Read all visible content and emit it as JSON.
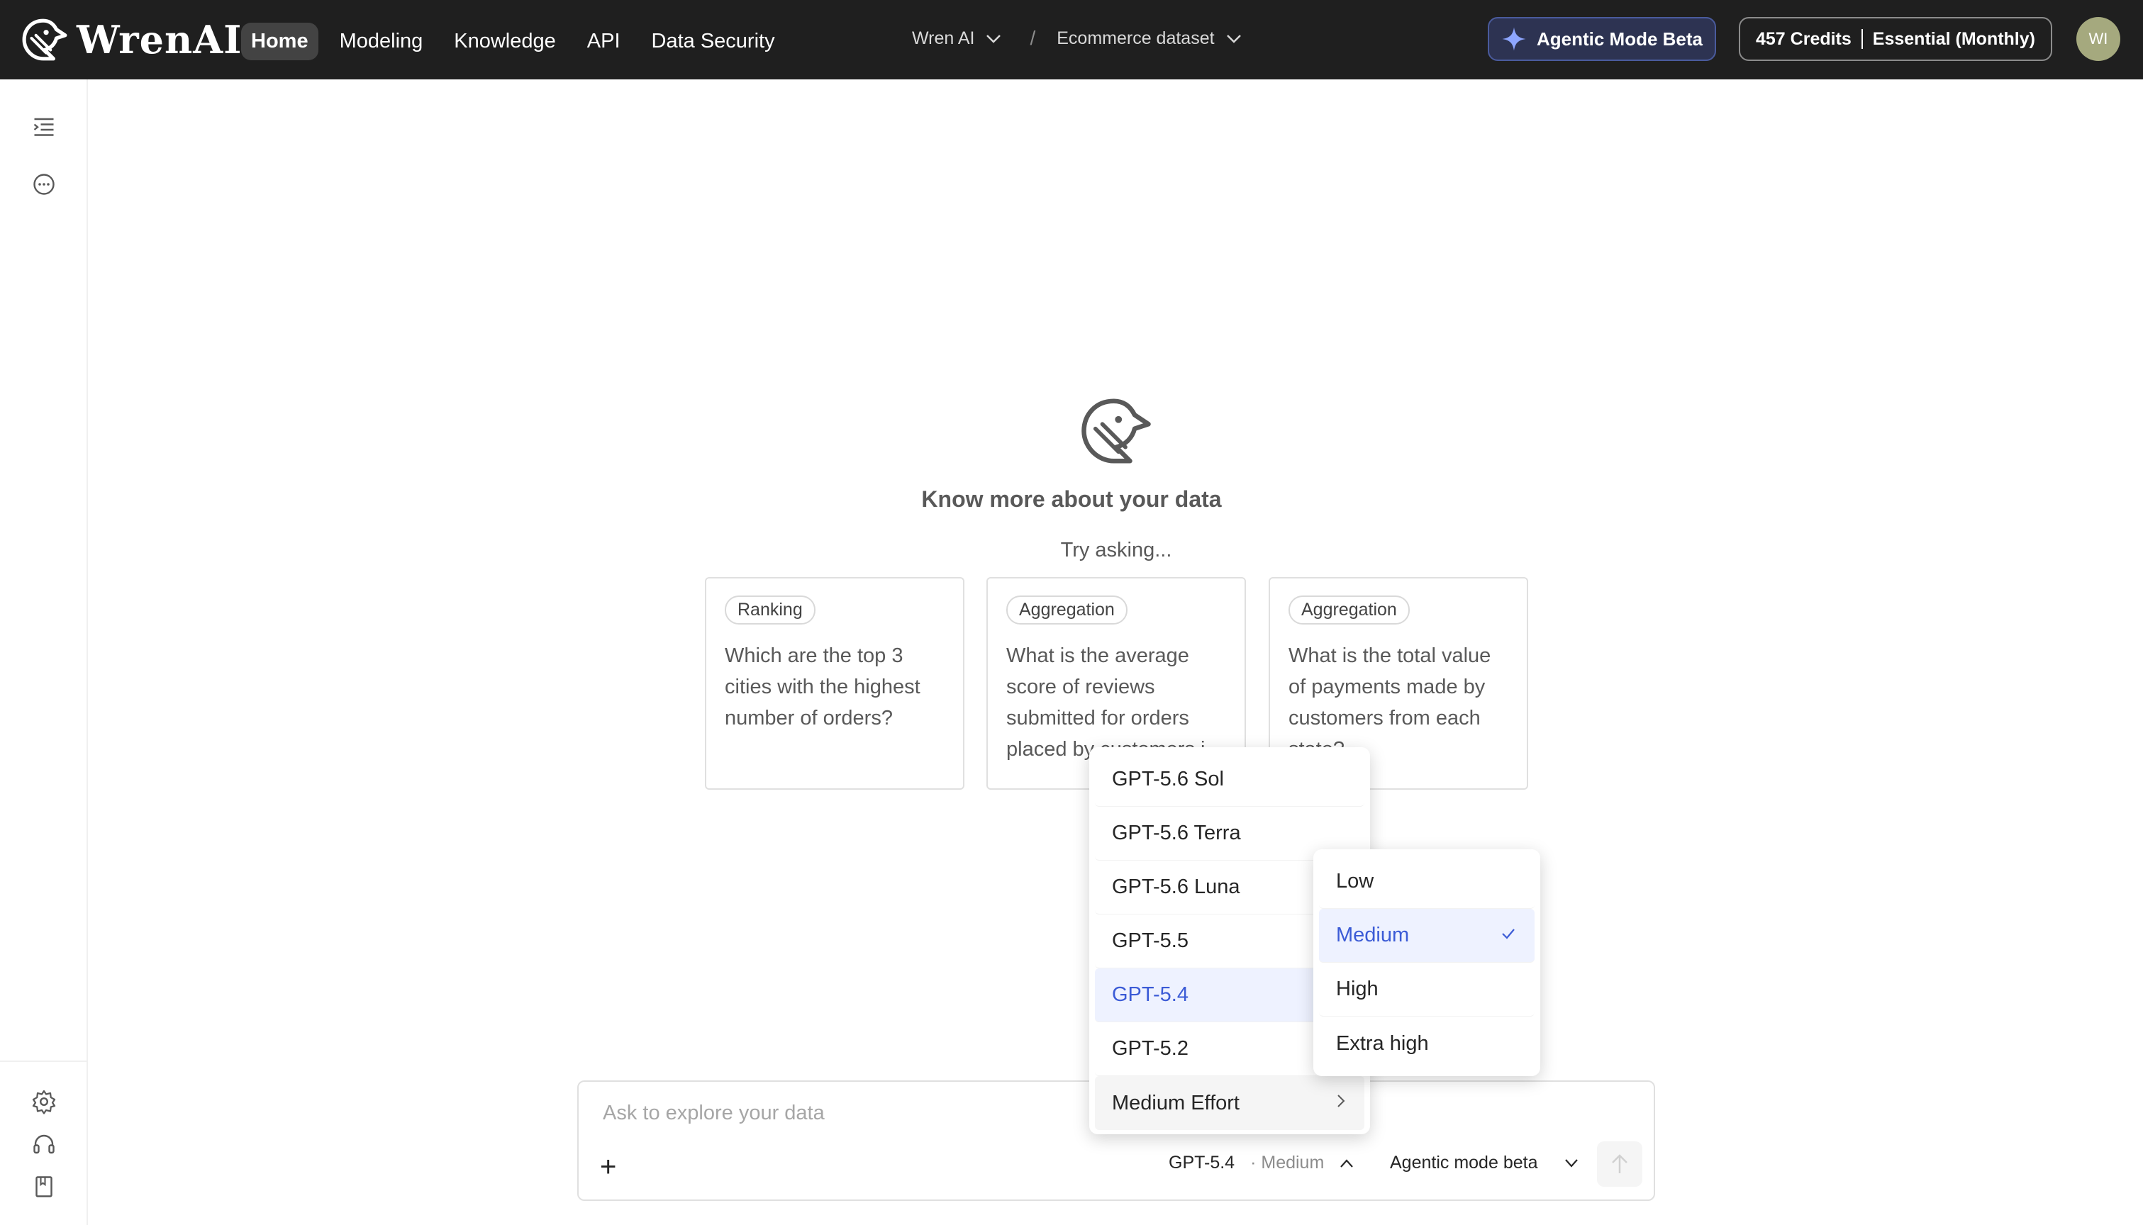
{
  "header": {
    "brand": "WrenAI",
    "nav": [
      "Home",
      "Modeling",
      "Knowledge",
      "API",
      "Data Security"
    ],
    "active_nav": "Home",
    "project": "Wren AI",
    "separator": "/",
    "dataset": "Ecommerce dataset",
    "agentic_button": "Agentic Mode Beta",
    "credits": "457 Credits",
    "plan": "Essential (Monthly)",
    "avatar_initials": "WI"
  },
  "main": {
    "title": "Know more about your data",
    "subtitle": "Try asking...",
    "cards": [
      {
        "tag": "Ranking",
        "question": "Which are the top 3 cities with the highest number of orders?"
      },
      {
        "tag": "Aggregation",
        "question": "What is the average score of reviews submitted for orders placed by customers i..."
      },
      {
        "tag": "Aggregation",
        "question": "What is the total value of payments made by customers from each state?"
      }
    ]
  },
  "composer": {
    "placeholder": "Ask to explore your data",
    "model": "GPT-5.4",
    "effort": "· Medium",
    "mode": "Agentic mode beta"
  },
  "model_menu": {
    "items": [
      "GPT-5.6 Sol",
      "GPT-5.6 Terra",
      "GPT-5.6 Luna",
      "GPT-5.5",
      "GPT-5.4",
      "GPT-5.2"
    ],
    "selected": "GPT-5.4",
    "effort_item": "Medium Effort"
  },
  "effort_menu": {
    "items": [
      "Low",
      "Medium",
      "High",
      "Extra high"
    ],
    "selected": "Medium"
  },
  "colors": {
    "topbar": "#1f1f1f",
    "accent": "#3b5bd6",
    "selected_bg": "#eef2ff"
  }
}
